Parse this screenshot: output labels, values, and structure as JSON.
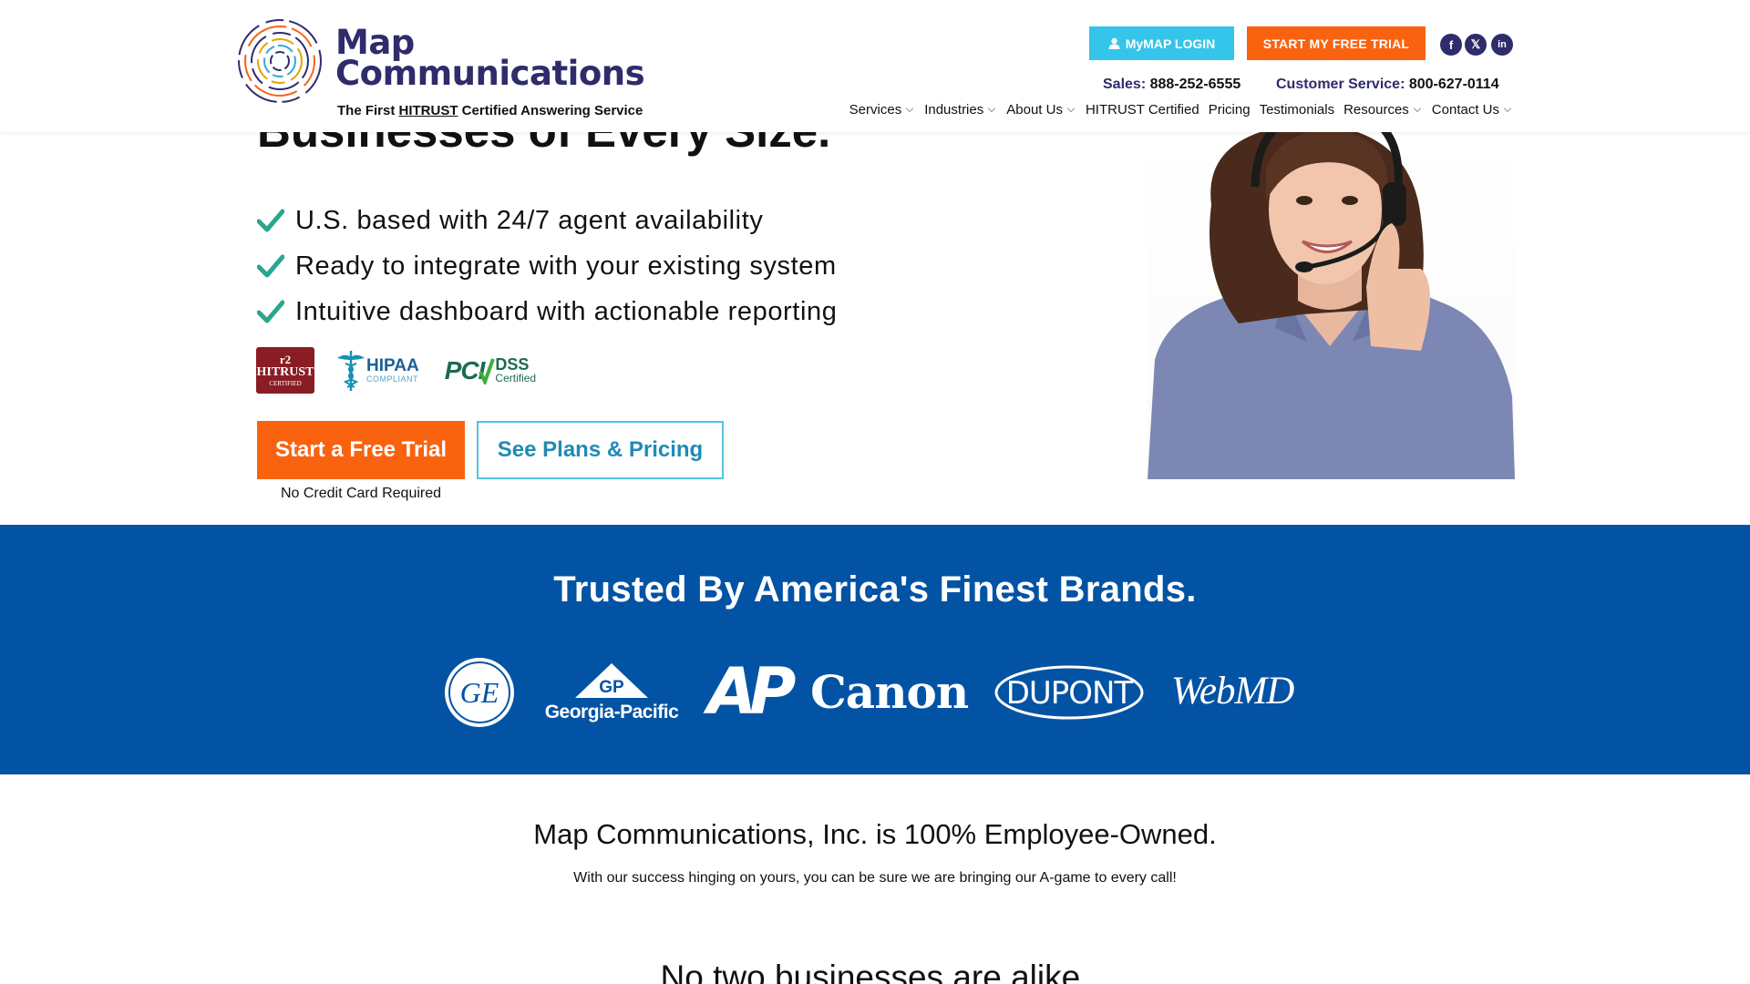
{
  "header": {
    "logo_line1": "Map",
    "logo_line2": "Communications",
    "tagline_before": "The First ",
    "tagline_underlined": "HITRUST",
    "tagline_after": " Certified Answering Service",
    "login_label": "MyMAP LOGIN",
    "trial_label": "START MY FREE TRIAL",
    "social": [
      "f",
      "𝕏",
      "in"
    ],
    "sales_label": "Sales:",
    "sales_number": "888-252-6555",
    "cs_label": "Customer Service:",
    "cs_number": "800-627-0114",
    "nav": [
      {
        "label": "Services",
        "dropdown": true
      },
      {
        "label": "Industries",
        "dropdown": true
      },
      {
        "label": "About Us",
        "dropdown": true
      },
      {
        "label": "HITRUST Certified",
        "dropdown": false
      },
      {
        "label": "Pricing",
        "dropdown": false
      },
      {
        "label": "Testimonials",
        "dropdown": false
      },
      {
        "label": "Resources",
        "dropdown": true
      },
      {
        "label": "Contact Us",
        "dropdown": true
      }
    ]
  },
  "hero": {
    "title_partial": "Businesses of Every Size.",
    "checks": [
      "U.S. based with 24/7 agent availability",
      "Ready to integrate with your existing system",
      "Intuitive dashboard with actionable reporting"
    ],
    "badges": {
      "hitrust_top": "r2",
      "hitrust_mid": "HITRUST",
      "hitrust_bottom": "CERTIFIED",
      "hipaa": "HIPAA",
      "hipaa_sub": "COMPLIANT",
      "pci": "PCI",
      "dss": "DSS",
      "pci_certified": "Certified"
    },
    "cta_primary": "Start a Free Trial",
    "cta_secondary": "See Plans & Pricing",
    "cta_note": "No Credit Card Required"
  },
  "brands": {
    "title": "Trusted By America's Finest Brands.",
    "logos": [
      "GE",
      "GP",
      "Georgia-Pacific",
      "AP",
      "Canon",
      "DUPONT",
      "WebMD"
    ]
  },
  "owned": {
    "title": "Map Communications, Inc. is 100% Employee-Owned.",
    "subtitle": "With our success hinging on yours, you can be sure we are bringing our A-game to every call!",
    "next_title": "No two businesses are alike."
  },
  "colors": {
    "brand_navy": "#2e2c6b",
    "accent_orange": "#f96310",
    "accent_cyan": "#35c5ea",
    "brands_band": "#0353a4",
    "check_green": "#2aa68f"
  }
}
